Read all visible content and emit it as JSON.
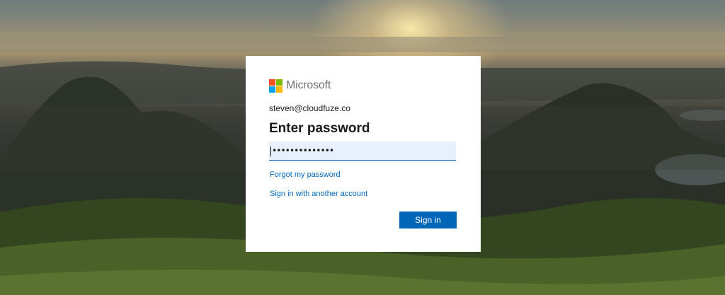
{
  "brand": {
    "name": "Microsoft",
    "logo_colors": [
      "#f25022",
      "#7fba00",
      "#00a4ef",
      "#ffb900"
    ]
  },
  "login": {
    "account_email": "steven@cloudfuze.co",
    "heading": "Enter password",
    "password_masked": "••••••••••••••",
    "forgot_link": "Forgot my password",
    "other_account_link": "Sign in with another account",
    "sign_in_label": "Sign in"
  },
  "colors": {
    "accent": "#0067b8",
    "input_fill": "#e8f0fe"
  }
}
